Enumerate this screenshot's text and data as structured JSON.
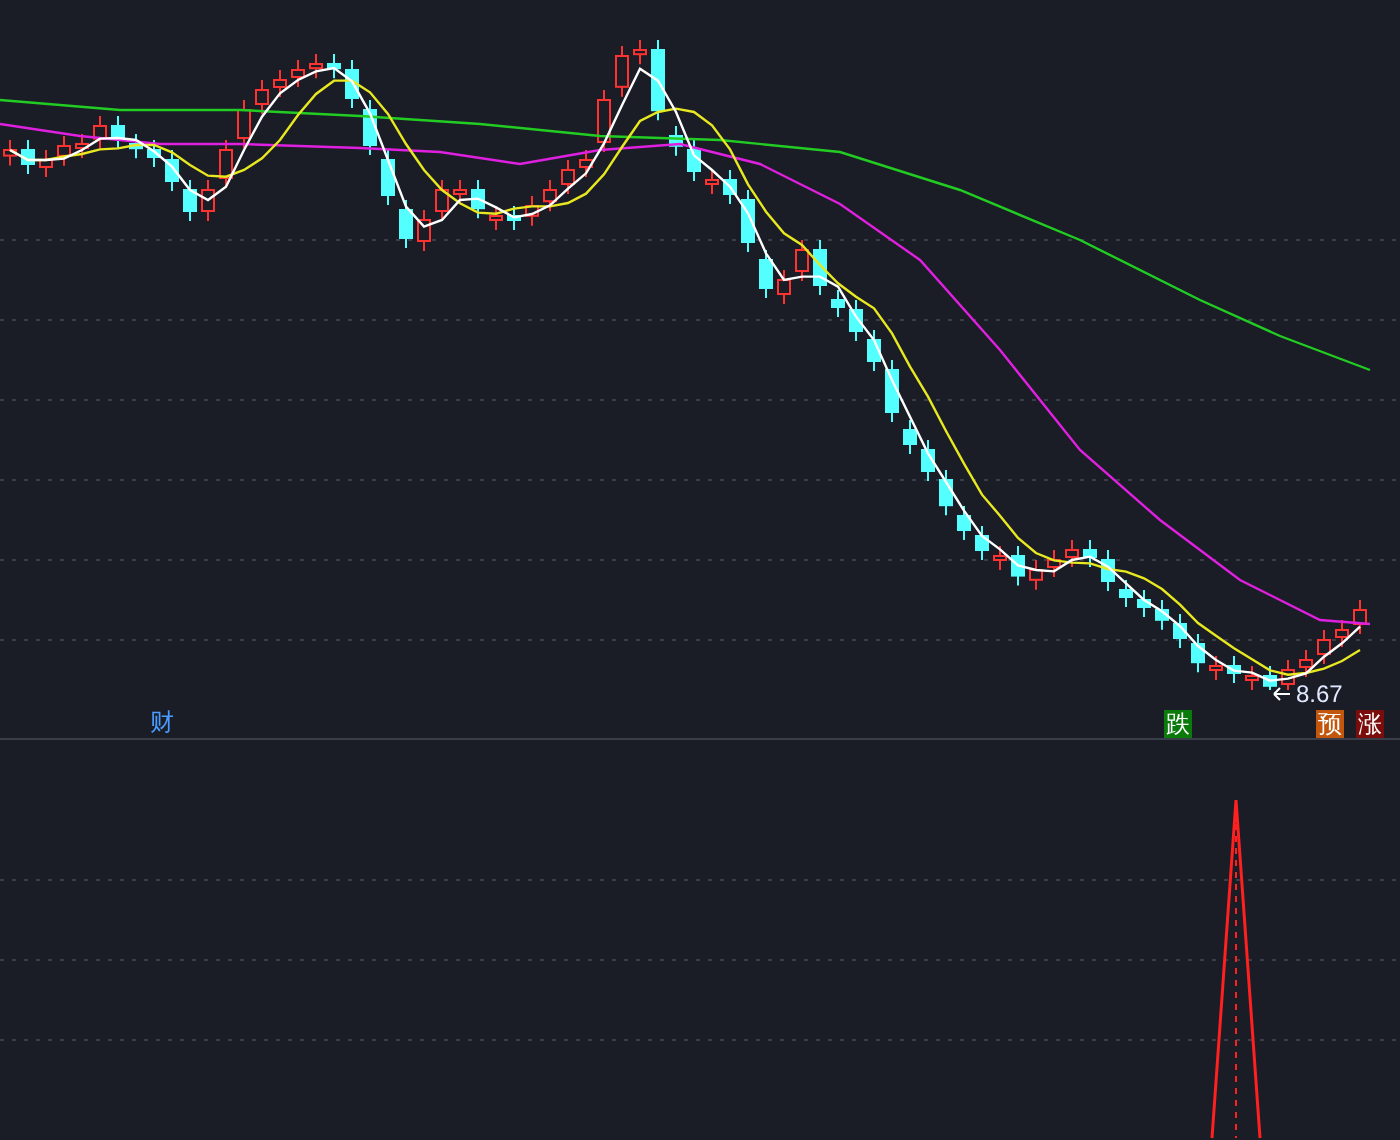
{
  "price_chart": {
    "low_price_label": "8.67",
    "markers": [
      {
        "text": "财",
        "kind": "plain",
        "color": "#4a9cff"
      },
      {
        "text": "跌",
        "kind": "badge",
        "color": "#0a7a0a"
      },
      {
        "text": "预",
        "kind": "badge",
        "color": "#c2560c"
      },
      {
        "text": "涨",
        "kind": "badge",
        "color": "#7a0c0c"
      }
    ]
  }
}
